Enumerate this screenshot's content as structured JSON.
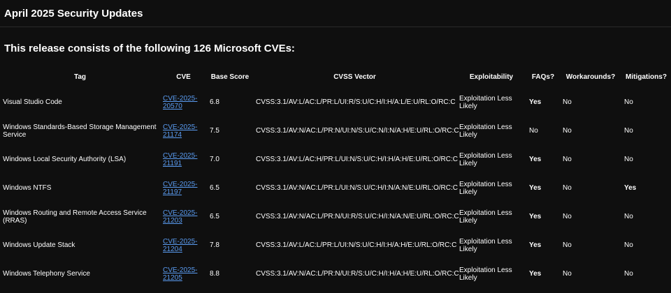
{
  "page": {
    "title": "April 2025 Security Updates"
  },
  "section": {
    "heading": "This release consists of the following 126 Microsoft CVEs:"
  },
  "table": {
    "headers": {
      "tag": "Tag",
      "cve": "CVE",
      "base_score": "Base Score",
      "cvss_vector": "CVSS Vector",
      "exploitability": "Exploitability",
      "faqs": "FAQs?",
      "workarounds": "Workarounds?",
      "mitigations": "Mitigations?"
    },
    "rows": [
      {
        "tag": "Visual Studio Code",
        "cve": "CVE-2025-20570",
        "base_score": "6.8",
        "cvss_vector": "CVSS:3.1/AV:L/AC:L/PR:L/UI:R/S:U/C:H/I:H/A:L/E:U/RL:O/RC:C",
        "exploitability": "Exploitation Less Likely",
        "faqs": "Yes",
        "workarounds": "No",
        "mitigations": "No"
      },
      {
        "tag": "Windows Standards-Based Storage Management Service",
        "cve": "CVE-2025-21174",
        "base_score": "7.5",
        "cvss_vector": "CVSS:3.1/AV:N/AC:L/PR:N/UI:N/S:U/C:N/I:N/A:H/E:U/RL:O/RC:C",
        "exploitability": "Exploitation Less Likely",
        "faqs": "No",
        "workarounds": "No",
        "mitigations": "No"
      },
      {
        "tag": "Windows Local Security Authority (LSA)",
        "cve": "CVE-2025-21191",
        "base_score": "7.0",
        "cvss_vector": "CVSS:3.1/AV:L/AC:H/PR:L/UI:N/S:U/C:H/I:H/A:H/E:U/RL:O/RC:C",
        "exploitability": "Exploitation Less Likely",
        "faqs": "Yes",
        "workarounds": "No",
        "mitigations": "No"
      },
      {
        "tag": "Windows NTFS",
        "cve": "CVE-2025-21197",
        "base_score": "6.5",
        "cvss_vector": "CVSS:3.1/AV:N/AC:L/PR:L/UI:N/S:U/C:H/I:N/A:N/E:U/RL:O/RC:C",
        "exploitability": "Exploitation Less Likely",
        "faqs": "Yes",
        "workarounds": "No",
        "mitigations": "Yes"
      },
      {
        "tag": "Windows Routing and Remote Access Service (RRAS)",
        "cve": "CVE-2025-21203",
        "base_score": "6.5",
        "cvss_vector": "CVSS:3.1/AV:N/AC:L/PR:N/UI:R/S:U/C:H/I:N/A:N/E:U/RL:O/RC:C",
        "exploitability": "Exploitation Less Likely",
        "faqs": "Yes",
        "workarounds": "No",
        "mitigations": "No"
      },
      {
        "tag": "Windows Update Stack",
        "cve": "CVE-2025-21204",
        "base_score": "7.8",
        "cvss_vector": "CVSS:3.1/AV:L/AC:L/PR:L/UI:N/S:U/C:H/I:H/A:H/E:U/RL:O/RC:C",
        "exploitability": "Exploitation Less Likely",
        "faqs": "Yes",
        "workarounds": "No",
        "mitigations": "No"
      },
      {
        "tag": "Windows Telephony Service",
        "cve": "CVE-2025-21205",
        "base_score": "8.8",
        "cvss_vector": "CVSS:3.1/AV:N/AC:L/PR:N/UI:R/S:U/C:H/I:H/A:H/E:U/RL:O/RC:C",
        "exploitability": "Exploitation Less Likely",
        "faqs": "Yes",
        "workarounds": "No",
        "mitigations": "No"
      }
    ]
  }
}
